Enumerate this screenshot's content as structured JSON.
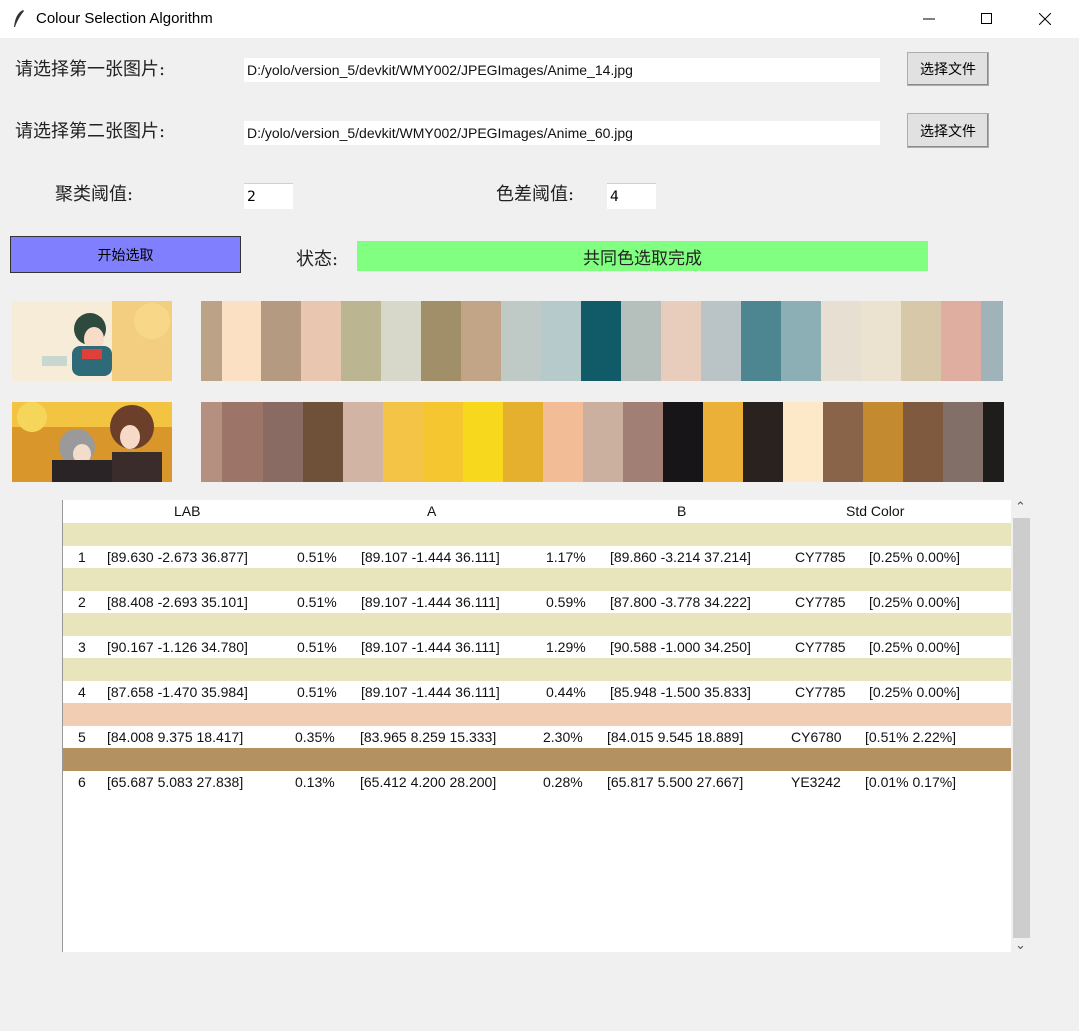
{
  "window": {
    "title": "Colour Selection Algorithm",
    "minimize_label": "—",
    "maximize_label": "☐",
    "close_label": "✕"
  },
  "form": {
    "label_img1": "请选择第一张图片:",
    "path_img1": "D:/yolo/version_5/devkit/WMY002/JPEGImages/Anime_14.jpg",
    "label_img2": "请选择第二张图片:",
    "path_img2": "D:/yolo/version_5/devkit/WMY002/JPEGImages/Anime_60.jpg",
    "browse_label": "选择文件",
    "cluster_label": "聚类阈值:",
    "cluster_value": "2",
    "diff_label": "色差阈值:",
    "diff_value": "4",
    "start_label": "开始选取",
    "status_label": "状态:",
    "status_value": "共同色选取完成",
    "status_color": "#80ff80",
    "start_color": "#8080ff"
  },
  "palette1": [
    "#bca388",
    "#fbe0c3",
    "#b59a82",
    "#e9c6b0",
    "#bbb592",
    "#d7d8c9",
    "#a08f68",
    "#c2a587",
    "#bfc9c6",
    "#b6cacb",
    "#115b68",
    "#b5bfbb",
    "#e8cdbd",
    "#bac3c5",
    "#4d8690",
    "#8bafb4",
    "#e7e0d2",
    "#ebe2cf",
    "#d6c8a9",
    "#e0aea0",
    "#9fb3b8"
  ],
  "palette2": [
    "#b58f80",
    "#9c7468",
    "#8a6b63",
    "#6f5038",
    "#d2b4a4",
    "#f4c447",
    "#f5c630",
    "#f8d81d",
    "#e4b02d",
    "#f2bd96",
    "#cbaf9f",
    "#a27f74",
    "#181519",
    "#eab038",
    "#2a221f",
    "#fde8c8",
    "#8a6448",
    "#c38a2f",
    "#805a3e",
    "#827068",
    "#1f1c1c"
  ],
  "palette_widths": [
    21,
    39,
    40,
    40,
    40,
    40,
    40,
    40,
    40,
    40,
    40,
    40,
    40,
    40,
    40,
    40,
    40,
    40,
    40,
    40,
    22
  ],
  "palette2_widths": [
    21,
    41,
    40,
    40,
    40,
    40,
    40,
    40,
    40,
    40,
    40,
    40,
    40,
    40,
    40,
    40,
    40,
    40,
    40,
    40,
    21
  ],
  "table": {
    "headers": [
      "LAB",
      "A",
      "B",
      "Std Color"
    ],
    "rows": [
      {
        "idx": "1",
        "lab": "[89.630 -2.673 36.877]",
        "pa": "0.51%",
        "a": "[89.107 -1.444 36.111]",
        "pb": "1.17%",
        "b": "[89.860 -3.214 37.214]",
        "std": "CY7785",
        "pct": "[0.25% 0.00%]",
        "color": "#e8e4bb"
      },
      {
        "idx": "2",
        "lab": "[88.408 -2.693 35.101]",
        "pa": "0.51%",
        "a": "[89.107 -1.444 36.111]",
        "pb": "0.59%",
        "b": "[87.800 -3.778 34.222]",
        "std": "CY7785",
        "pct": "[0.25% 0.00%]",
        "color": "#e8e4bb"
      },
      {
        "idx": "3",
        "lab": "[90.167 -1.126 34.780]",
        "pa": "0.51%",
        "a": "[89.107 -1.444 36.111]",
        "pb": "1.29%",
        "b": "[90.588 -1.000 34.250]",
        "std": "CY7785",
        "pct": "[0.25% 0.00%]",
        "color": "#e8e4bb"
      },
      {
        "idx": "4",
        "lab": "[87.658 -1.470 35.984]",
        "pa": "0.51%",
        "a": "[89.107 -1.444 36.111]",
        "pb": "0.44%",
        "b": "[85.948 -1.500 35.833]",
        "std": "CY7785",
        "pct": "[0.25% 0.00%]",
        "color": "#e8e4bb"
      },
      {
        "idx": "5",
        "lab": "[84.008 9.375 18.417]",
        "pa": "0.35%",
        "a": "[83.965 8.259 15.333]",
        "pb": "2.30%",
        "b": "[84.015 9.545 18.889]",
        "std": "CY6780",
        "pct": "[0.51% 2.22%]",
        "color": "#f0cdb3"
      },
      {
        "idx": "6",
        "lab": "[65.687 5.083 27.838]",
        "pa": "0.13%",
        "a": "[65.412 4.200 28.200]",
        "pb": "0.28%",
        "b": "[65.817 5.500 27.667]",
        "std": "YE3242",
        "pct": "[0.01% 0.17%]",
        "color": "#b39160"
      }
    ]
  },
  "scroll_up": "⌃",
  "scroll_down": "⌄"
}
